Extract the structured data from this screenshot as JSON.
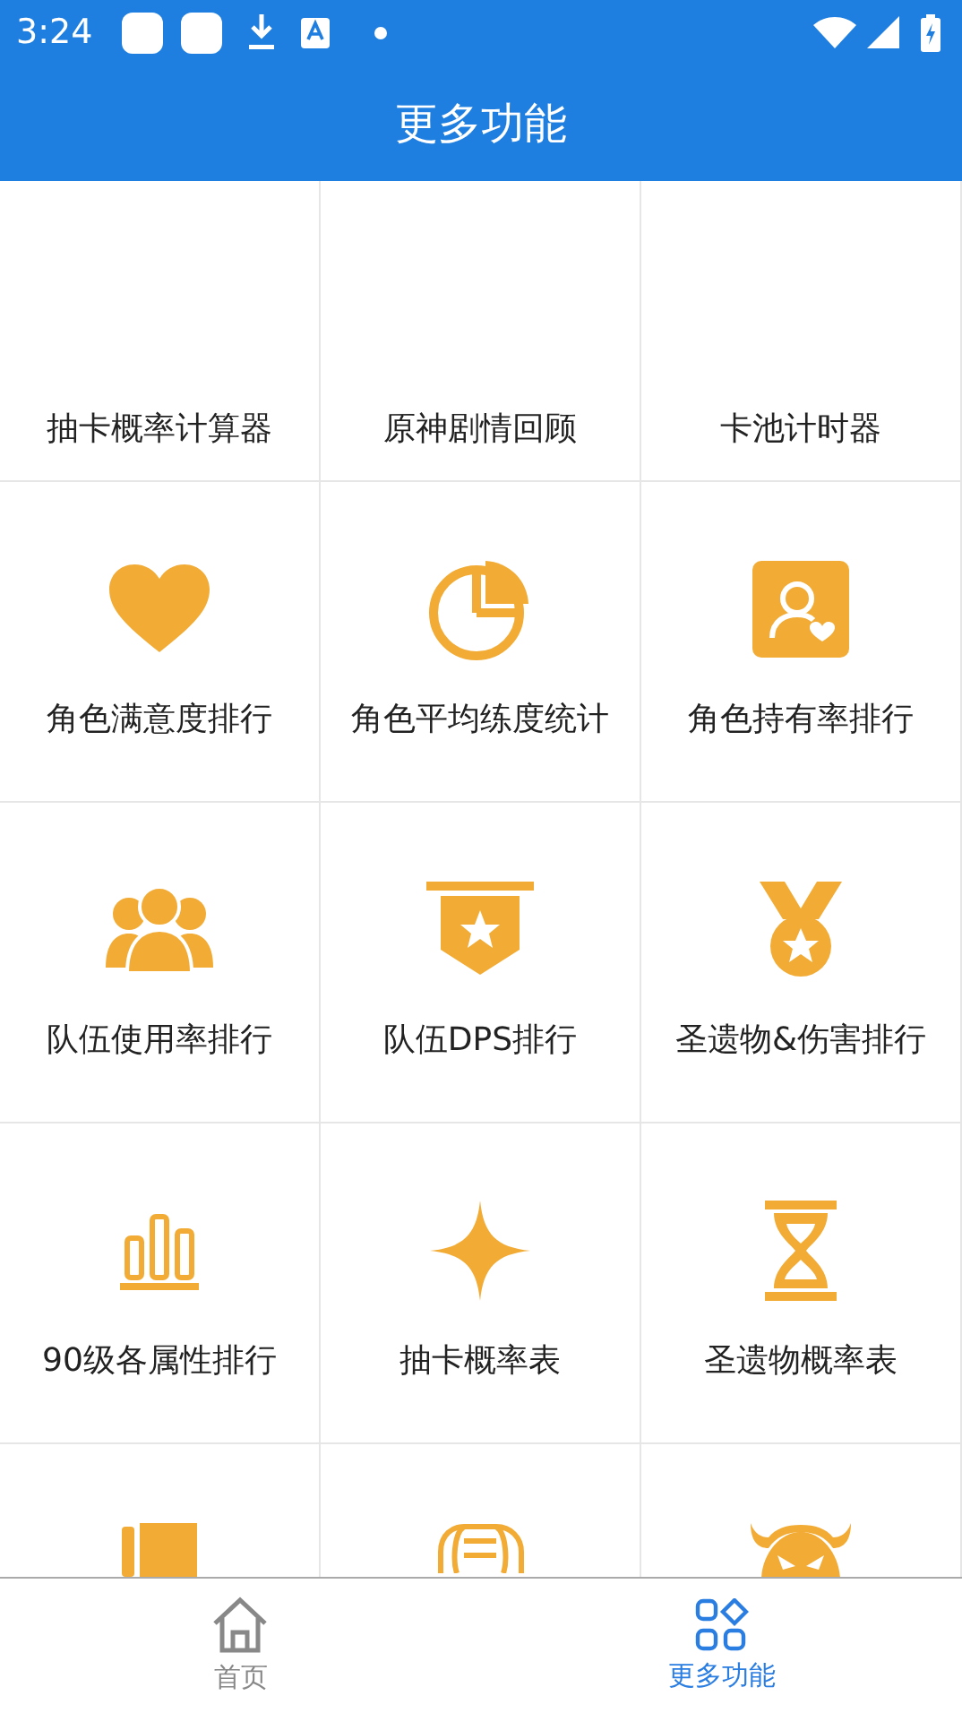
{
  "status_bar": {
    "time": "3:24"
  },
  "title_bar": {
    "title": "更多功能"
  },
  "grid": {
    "items": [
      {
        "label": "抽卡概率计算器"
      },
      {
        "label": "原神剧情回顾"
      },
      {
        "label": "卡池计时器"
      },
      {
        "label": "角色满意度排行"
      },
      {
        "label": "角色平均练度统计"
      },
      {
        "label": "角色持有率排行"
      },
      {
        "label": "队伍使用率排行"
      },
      {
        "label": "队伍DPS排行"
      },
      {
        "label": "圣遗物&伤害排行"
      },
      {
        "label": "90级各属性排行"
      },
      {
        "label": "抽卡概率表"
      },
      {
        "label": "圣遗物概率表"
      }
    ]
  },
  "bottom_nav": [
    {
      "label": "首页",
      "selected": false
    },
    {
      "label": "更多功能",
      "selected": true
    }
  ]
}
